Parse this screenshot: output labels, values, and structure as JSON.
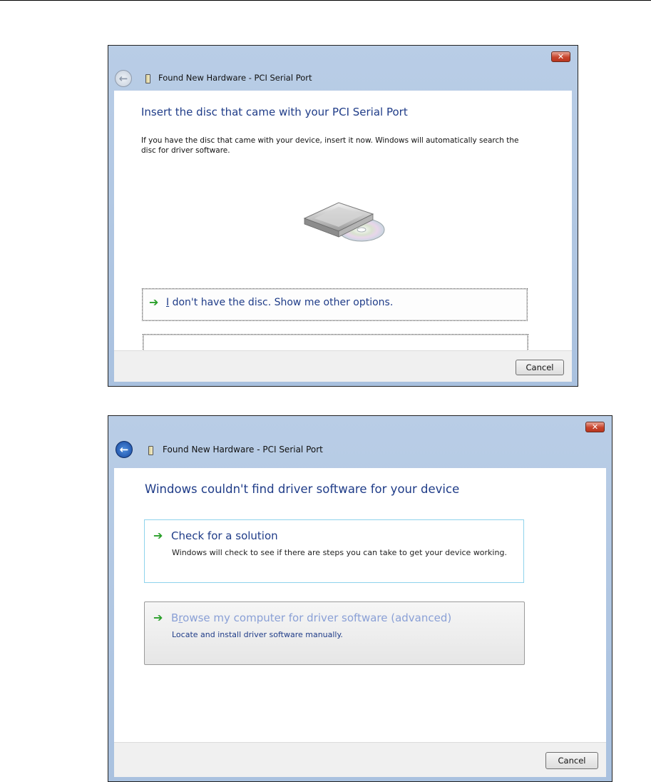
{
  "dialog1": {
    "title": "Found New Hardware - PCI Serial Port",
    "close_glyph": "✕",
    "heading": "Insert the disc that came with your PCI Serial Port",
    "description": "If you have the disc that came with your device, insert it now.  Windows will automatically search the disc for driver software.",
    "illustration": "disc-drive-icon",
    "option": {
      "mnemonic": "I",
      "label_rest": " don't have the disc.  Show me other options."
    },
    "cancel_label": "Cancel"
  },
  "dialog2": {
    "title": "Found New Hardware - PCI Serial Port",
    "close_glyph": "✕",
    "heading": "Windows couldn't find driver software for your device",
    "option1": {
      "title": "Check for a solution",
      "description": "Windows will check to see if there are steps you can take to get your device working."
    },
    "option2": {
      "title_before": "B",
      "mnemonic": "r",
      "title_after": "owse my computer for driver software (advanced)",
      "description": "Locate and install driver software manually."
    },
    "cancel_label": "Cancel"
  },
  "colors": {
    "heading": "#1f3c88",
    "arrow": "#2aa02a",
    "frame": "#b9cde6",
    "focus_border": "#8fd3ec"
  },
  "icons": [
    "back-arrow-icon",
    "hardware-device-icon",
    "close-icon",
    "disc-drive-icon",
    "green-arrow-icon"
  ]
}
